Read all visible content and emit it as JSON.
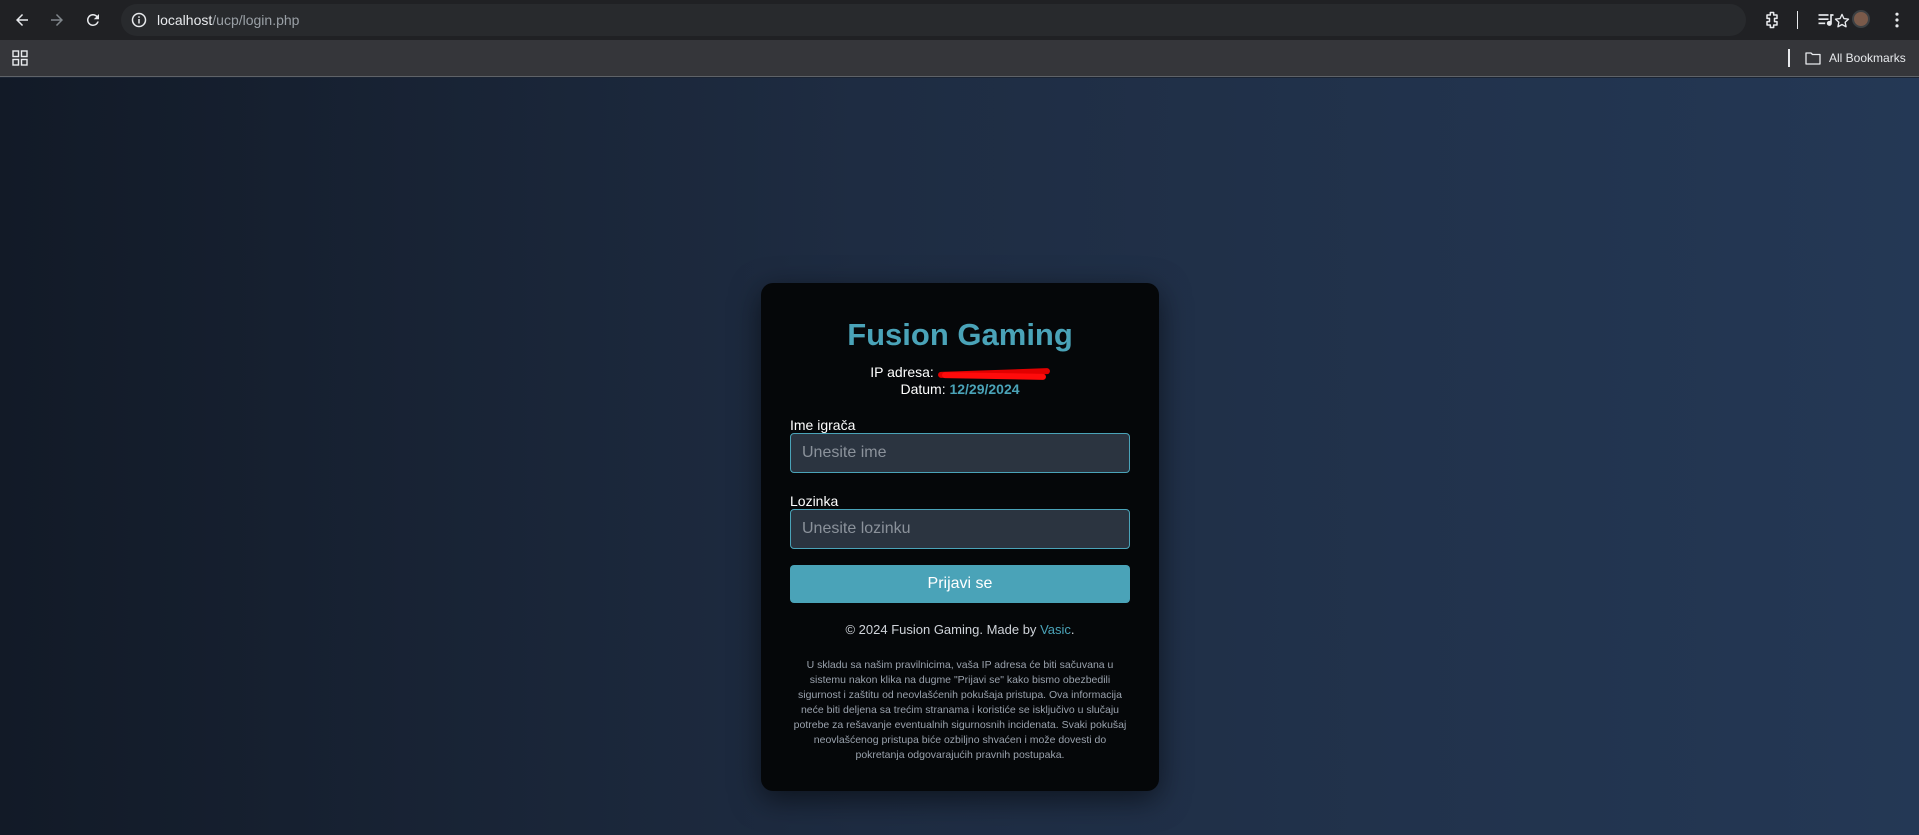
{
  "browser": {
    "url_host": "localhost",
    "url_path": "/ucp/login.php",
    "bookmarks": {
      "all_label": "All Bookmarks"
    }
  },
  "login": {
    "brand": "Fusion Gaming",
    "ip_label": "IP adresa:",
    "date_label": "Datum:",
    "date_value": "12/29/2024",
    "username_label": "Ime igrača",
    "username_placeholder": "Unesite ime",
    "password_label": "Lozinka",
    "password_placeholder": "Unesite lozinku",
    "submit_label": "Prijavi se",
    "copyright_text": "© 2024 Fusion Gaming. Made by",
    "author_link": "Vasic",
    "notice": "U skladu sa našim pravilnicima, vaša IP adresa će biti sačuvana u sistemu nakon klika na dugme \"Prijavi se\" kako bismo obezbedili sigurnost i zaštitu od neovlašćenih pokušaja pristupa. Ova informacija neće biti deljena sa trećim stranama i koristiće se isključivo u slučaju potrebe za rešavanje eventualnih sigurnosnih incidenata. Svaki pokušaj neovlašćenog pristupa biće ozbiljno shvaćen i može dovesti do pokretanja odgovarajućih pravnih postupaka."
  },
  "colors": {
    "accent": "#4aa3b8",
    "card_bg": "#050709",
    "input_bg": "#2b3440",
    "redaction": "#e10000"
  },
  "icons": [
    "back-arrow-icon",
    "forward-arrow-icon",
    "reload-icon",
    "info-icon",
    "star-icon",
    "extensions-icon",
    "media-queue-icon",
    "profile-avatar",
    "more-vert-icon",
    "apps-grid-icon",
    "folder-icon"
  ]
}
